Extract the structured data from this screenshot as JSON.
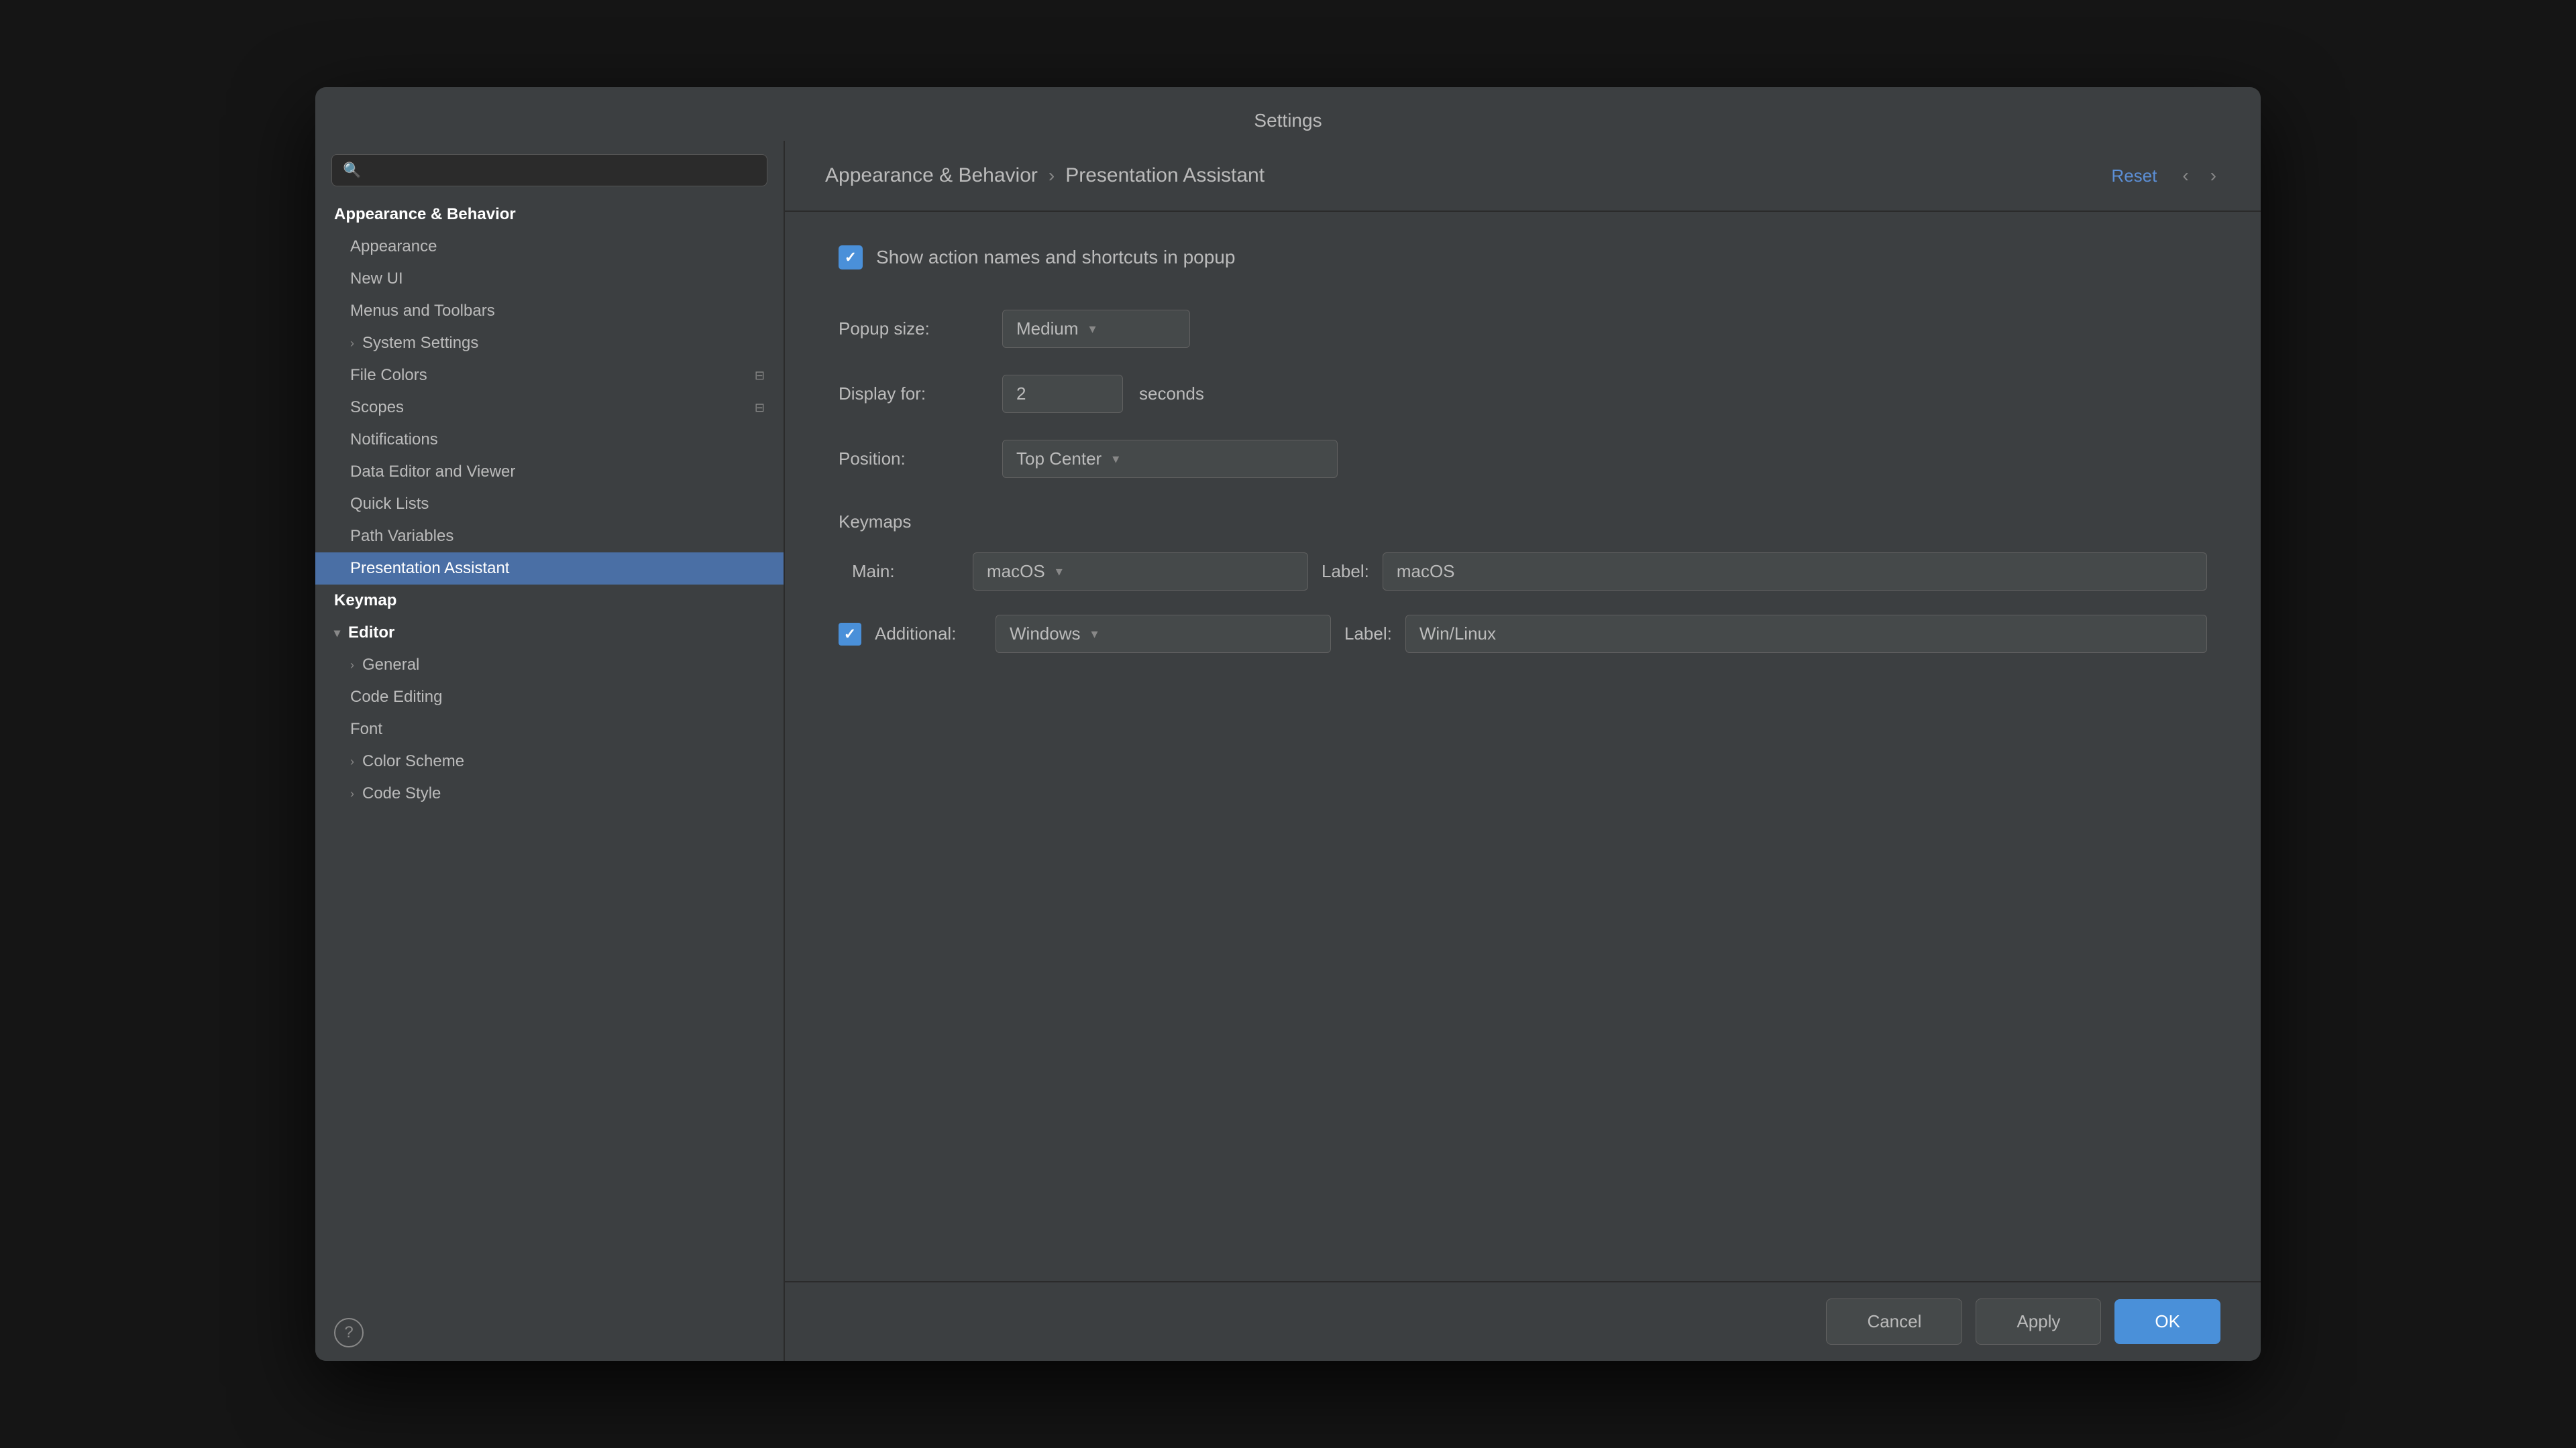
{
  "dialog": {
    "title": "Settings",
    "breadcrumb": "Appearance & Behavior",
    "breadcrumb_separator": "›",
    "breadcrumb_current": "Presentation Assistant",
    "reset_label": "Reset",
    "nav_back": "‹",
    "nav_forward": "›"
  },
  "search": {
    "placeholder": "🔍"
  },
  "sidebar": {
    "items": [
      {
        "id": "appearance-behavior",
        "label": "Appearance & Behavior",
        "level": 0,
        "bold": true,
        "selected": false,
        "chevron": "",
        "badge": ""
      },
      {
        "id": "appearance",
        "label": "Appearance",
        "level": 1,
        "bold": false,
        "selected": false,
        "chevron": "",
        "badge": ""
      },
      {
        "id": "new-ui",
        "label": "New UI",
        "level": 1,
        "bold": false,
        "selected": false,
        "chevron": "",
        "badge": ""
      },
      {
        "id": "menus-toolbars",
        "label": "Menus and Toolbars",
        "level": 1,
        "bold": false,
        "selected": false,
        "chevron": "",
        "badge": ""
      },
      {
        "id": "system-settings",
        "label": "System Settings",
        "level": 1,
        "bold": false,
        "selected": false,
        "chevron": "›",
        "badge": ""
      },
      {
        "id": "file-colors",
        "label": "File Colors",
        "level": 1,
        "bold": false,
        "selected": false,
        "chevron": "",
        "badge": "⊟"
      },
      {
        "id": "scopes",
        "label": "Scopes",
        "level": 1,
        "bold": false,
        "selected": false,
        "chevron": "",
        "badge": "⊟"
      },
      {
        "id": "notifications",
        "label": "Notifications",
        "level": 1,
        "bold": false,
        "selected": false,
        "chevron": "",
        "badge": ""
      },
      {
        "id": "data-editor",
        "label": "Data Editor and Viewer",
        "level": 1,
        "bold": false,
        "selected": false,
        "chevron": "",
        "badge": ""
      },
      {
        "id": "quick-lists",
        "label": "Quick Lists",
        "level": 1,
        "bold": false,
        "selected": false,
        "chevron": "",
        "badge": ""
      },
      {
        "id": "path-variables",
        "label": "Path Variables",
        "level": 1,
        "bold": false,
        "selected": false,
        "chevron": "",
        "badge": ""
      },
      {
        "id": "presentation-assistant",
        "label": "Presentation Assistant",
        "level": 1,
        "bold": false,
        "selected": true,
        "chevron": "",
        "badge": ""
      },
      {
        "id": "keymap",
        "label": "Keymap",
        "level": 0,
        "bold": true,
        "selected": false,
        "chevron": "",
        "badge": ""
      },
      {
        "id": "editor",
        "label": "Editor",
        "level": 0,
        "bold": true,
        "selected": false,
        "chevron": "▾",
        "badge": ""
      },
      {
        "id": "general",
        "label": "General",
        "level": 1,
        "bold": false,
        "selected": false,
        "chevron": "›",
        "badge": ""
      },
      {
        "id": "code-editing",
        "label": "Code Editing",
        "level": 1,
        "bold": false,
        "selected": false,
        "chevron": "",
        "badge": ""
      },
      {
        "id": "font",
        "label": "Font",
        "level": 1,
        "bold": false,
        "selected": false,
        "chevron": "",
        "badge": ""
      },
      {
        "id": "color-scheme",
        "label": "Color Scheme",
        "level": 1,
        "bold": false,
        "selected": false,
        "chevron": "›",
        "badge": ""
      },
      {
        "id": "code-style",
        "label": "Code Style",
        "level": 1,
        "bold": false,
        "selected": false,
        "chevron": "›",
        "badge": ""
      }
    ]
  },
  "content": {
    "show_action_checkbox": true,
    "show_action_label": "Show action names and shortcuts in popup",
    "popup_size_label": "Popup size:",
    "popup_size_value": "Medium",
    "display_for_label": "Display for:",
    "display_for_value": "2",
    "display_for_unit": "seconds",
    "position_label": "Position:",
    "position_value": "Top Center",
    "keymaps_title": "Keymaps",
    "main_label": "Main:",
    "main_value": "macOS",
    "main_label_label": "Label:",
    "main_label_value": "macOS",
    "additional_checked": true,
    "additional_label": "Additional:",
    "additional_value": "Windows",
    "additional_label_label": "Label:",
    "additional_label_value": "Win/Linux"
  },
  "footer": {
    "help_icon": "?",
    "cancel_label": "Cancel",
    "apply_label": "Apply",
    "ok_label": "OK"
  }
}
